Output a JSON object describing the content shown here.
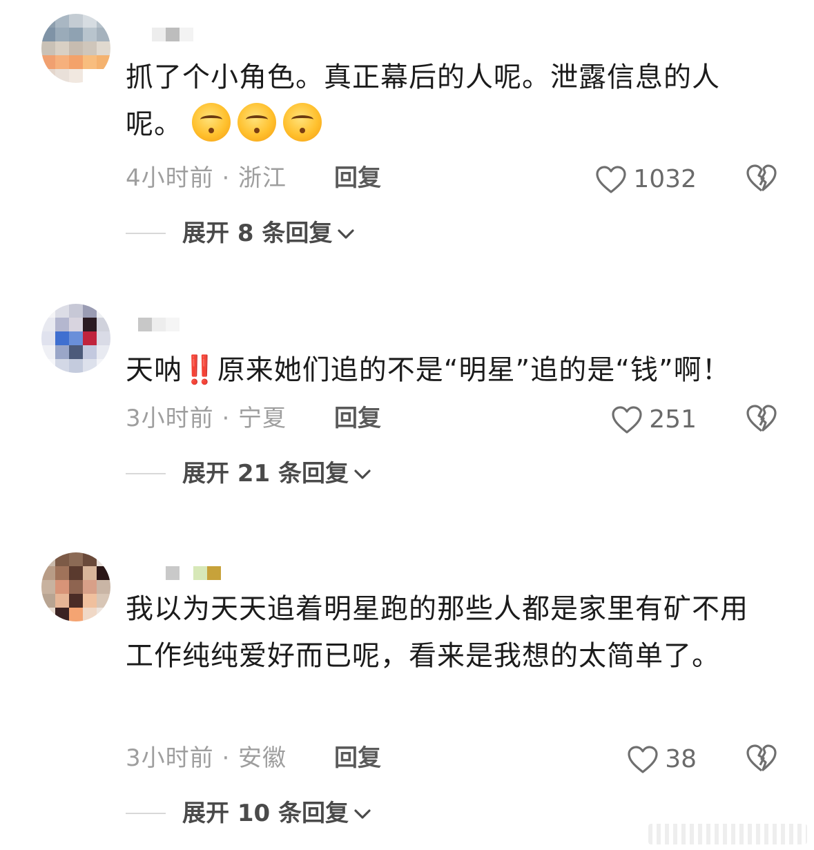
{
  "comments": [
    {
      "text": "抓了个小角色。真正幕后的人呢。泄露信息的人呢。",
      "emoji_count": 3,
      "meta": "4小时前 · 浙江",
      "reply_label": "回复",
      "likes": "1032",
      "expand_label": "展开 8 条回复"
    },
    {
      "text_before": "天呐",
      "text_after": "原来她们追的不是“明星”追的是“钱”啊！",
      "emphasis": "‼️",
      "meta": "3小时前 · 宁夏",
      "reply_label": "回复",
      "likes": "251",
      "expand_label": "展开 21 条回复"
    },
    {
      "text": "我以为天天追着明星跑的那些人都是家里有矿不用工作纯纯爱好而已呢，看来是我想的太简单了。",
      "meta": "3小时前 · 安徽",
      "reply_label": "回复",
      "likes": "38",
      "expand_label": "展开 10 条回复"
    }
  ],
  "icons": {
    "like": "heart-outline-icon",
    "dislike": "broken-heart-icon",
    "expand": "chevron-down-icon"
  }
}
